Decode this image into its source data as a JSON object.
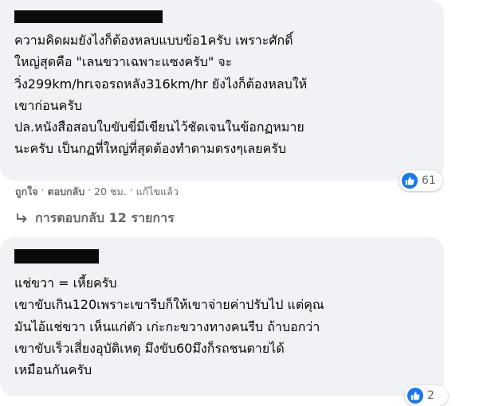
{
  "comment1": {
    "lines": [
      "ความคิดผมยังไงก็ต้องหลบแบบข้อ1ครับ เพราะศักดิ์",
      "ใหญ่สุดคือ \"เลนขวาเฉพาะแซงครับ\" จะ",
      "วิ่ง299km/hrเจอรถหลัง316km/hr ยังไงก็ต้องหลบให้",
      "เขาก่อนครับ",
      "ปล.หนังสือสอบใบขับขี่มีเขียนไว้ชัดเจนในข้อกฏหมาย",
      "นะครับ เป็นกฏที่ใหญ่ที่สุดต้องทำตามตรงๆเลยครับ"
    ],
    "reaction_count": "61",
    "actions": {
      "like": "ถูกใจ",
      "sep1": " · ",
      "reply": "ตอบกลับ",
      "sep2": " · ",
      "time": "20 ชม.",
      "sep3": " · ",
      "edited": "แก้ไขแล้ว"
    }
  },
  "replies_link": {
    "label": "การตอบกลับ 12 รายการ"
  },
  "comment2": {
    "lines": [
      "แช่ขวา = เหี้ยครับ",
      "เขาขับเกิน120เพราะเขารีบก็ให้เขาจ่ายค่าปรับไป แต่คุณ",
      "มันไอ้แช่ขวา เห็นแก่ตัว เก่ะกะขวางทางคนรีบ ถ้าบอกว่า",
      "เขาขับเร็วเสี่ยงอุบัติเหตุ มึงขับ60มึงก็รถชนตายได้",
      "เหมือนกันครับ"
    ],
    "reaction_count": "2"
  },
  "colors": {
    "bubble": "#f0f2f5",
    "like_blue": "#1877f2",
    "meta_gray": "#65676b"
  },
  "icons": {
    "like": "thumbs-up-icon",
    "reply_arrow": "reply-arrow-icon"
  }
}
